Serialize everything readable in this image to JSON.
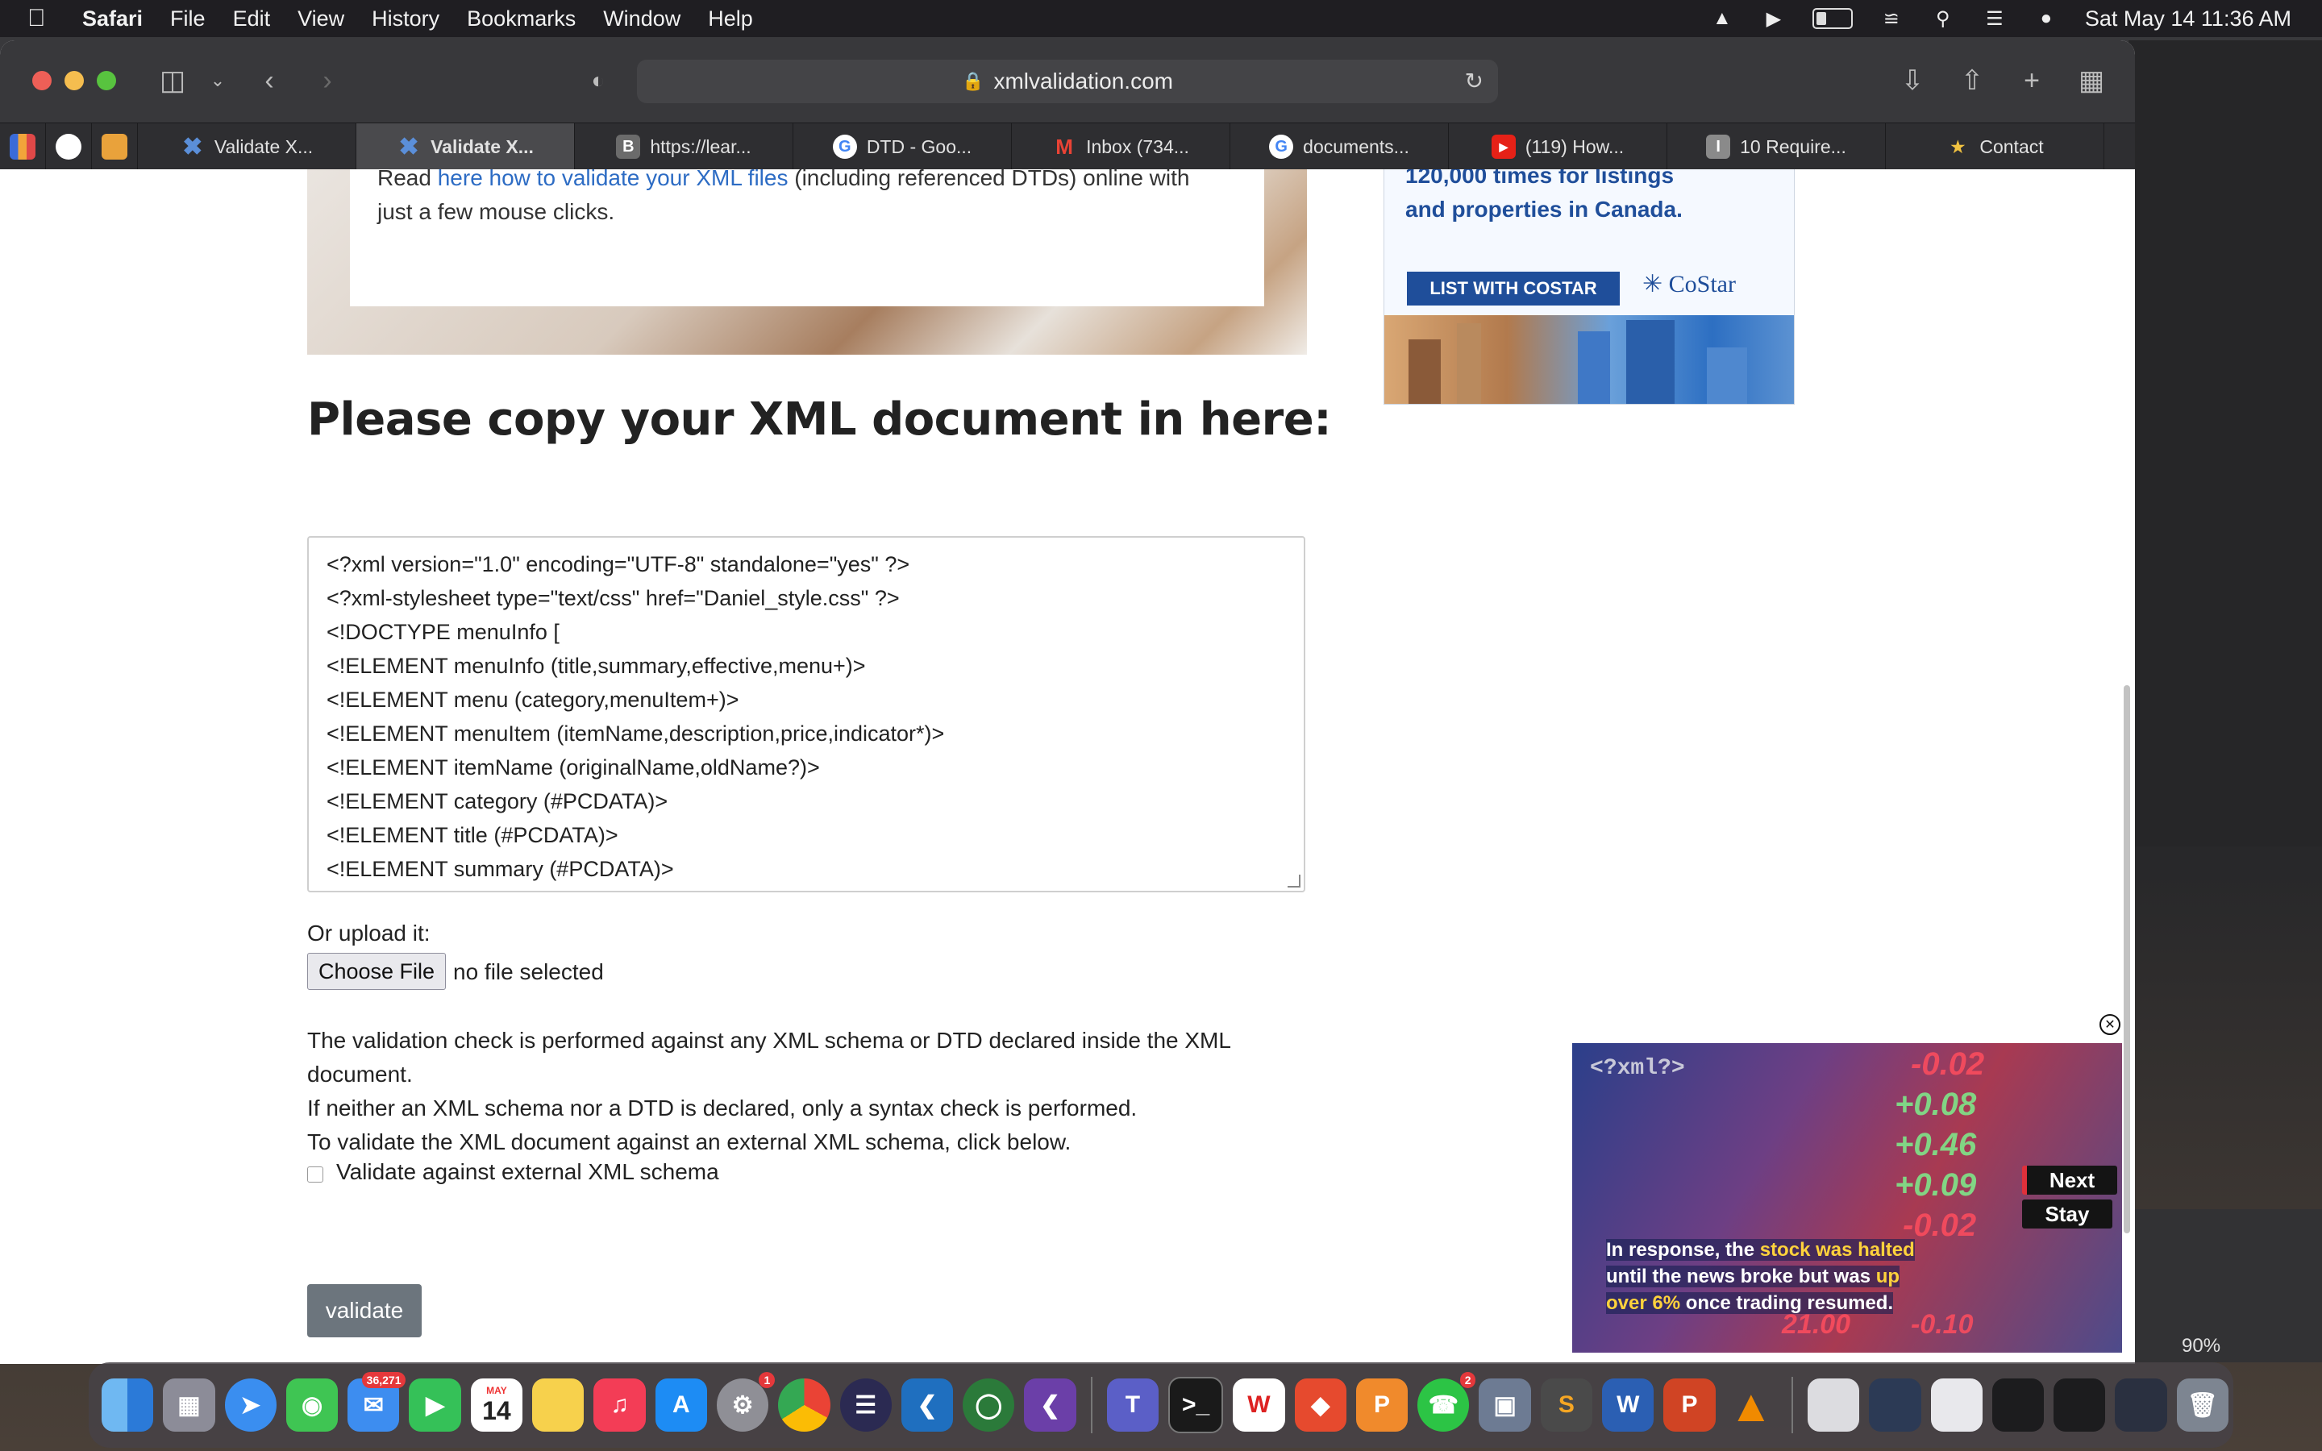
{
  "menubar": {
    "app": "Safari",
    "items": [
      "File",
      "Edit",
      "View",
      "History",
      "Bookmarks",
      "Window",
      "Help"
    ],
    "clock": "Sat May 14  11:36 AM"
  },
  "browser": {
    "url": "xmlvalidation.com",
    "tabs": [
      {
        "label": "Validate X...",
        "icon": "x-icon",
        "color": "#5b8fd9"
      },
      {
        "label": "Validate X...",
        "icon": "x-icon",
        "color": "#5b8fd9",
        "active": true
      },
      {
        "label": "https://lear...",
        "icon": "b-icon",
        "color": "#6b6b6b"
      },
      {
        "label": "DTD - Goo...",
        "icon": "google-icon",
        "color": "#ffffff"
      },
      {
        "label": "Inbox (734...",
        "icon": "gmail-icon",
        "color": "#ffffff"
      },
      {
        "label": "documents...",
        "icon": "google-icon",
        "color": "#ffffff"
      },
      {
        "label": "(119) How...",
        "icon": "youtube-icon",
        "color": "#e62117"
      },
      {
        "label": "10 Require...",
        "icon": "i-icon",
        "color": "#8a8a8a"
      },
      {
        "label": "Contact",
        "icon": "contact-icon",
        "color": "#f2c341"
      }
    ]
  },
  "page": {
    "intro_prefix": "Read ",
    "intro_link": "here how to validate your XML files",
    "intro_suffix": " (including referenced DTDs) online with",
    "intro_line2": "just a few mouse clicks.",
    "heading": "Please copy your XML document in here:",
    "xml_lines": [
      "<?xml version=\"1.0\" encoding=\"UTF-8\" standalone=\"yes\" ?>",
      "<?xml-stylesheet type=\"text/css\" href=\"Daniel_style.css\" ?>",
      "<!DOCTYPE menuInfo [",
      "<!ELEMENT menuInfo (title,summary,effective,menu+)>",
      "<!ELEMENT menu (category,menuItem+)>",
      "<!ELEMENT menuItem (itemName,description,price,indicator*)>",
      "<!ELEMENT itemName (originalName,oldName?)>",
      "<!ELEMENT category (#PCDATA)>",
      "<!ELEMENT title (#PCDATA)>",
      "<!ELEMENT summary (#PCDATA)>"
    ],
    "upload_label": "Or upload it:",
    "choose_file": "Choose File",
    "no_file": "no file selected",
    "desc_1": "The validation check is performed against any XML schema or DTD declared inside the XML",
    "desc_1b": "document.",
    "desc_2": "If neither an XML schema nor a DTD is declared, only a syntax check is performed.",
    "desc_3": "To validate the XML document against an external XML schema, click below.",
    "checkbox_label": "Validate against external XML schema",
    "validate_button": "validate"
  },
  "ad": {
    "line1": "120,000 times for listings",
    "line2": "and properties in Canada.",
    "button": "LIST WITH COSTAR",
    "brand": "CoStar"
  },
  "video": {
    "logo": "<?xml?>",
    "next": "Next",
    "stay": "Stay",
    "caption_a": "In response, the ",
    "caption_hl1": "stock was halted",
    "caption_b": "until the news broke but was ",
    "caption_hl2": "up",
    "caption_hl3": "over 6%",
    "caption_c": " once trading resumed.",
    "tickers": [
      "-0.02",
      "+0.08",
      "+0.46",
      "+0.09",
      "-0.02",
      "21.00",
      "-0.10"
    ]
  },
  "side": {
    "zoom": "90%"
  },
  "dock": {
    "mail_badge": "36,271",
    "settings_badge": "1",
    "whatsapp_badge": "2",
    "calendar_month": "MAY",
    "calendar_day": "14"
  }
}
